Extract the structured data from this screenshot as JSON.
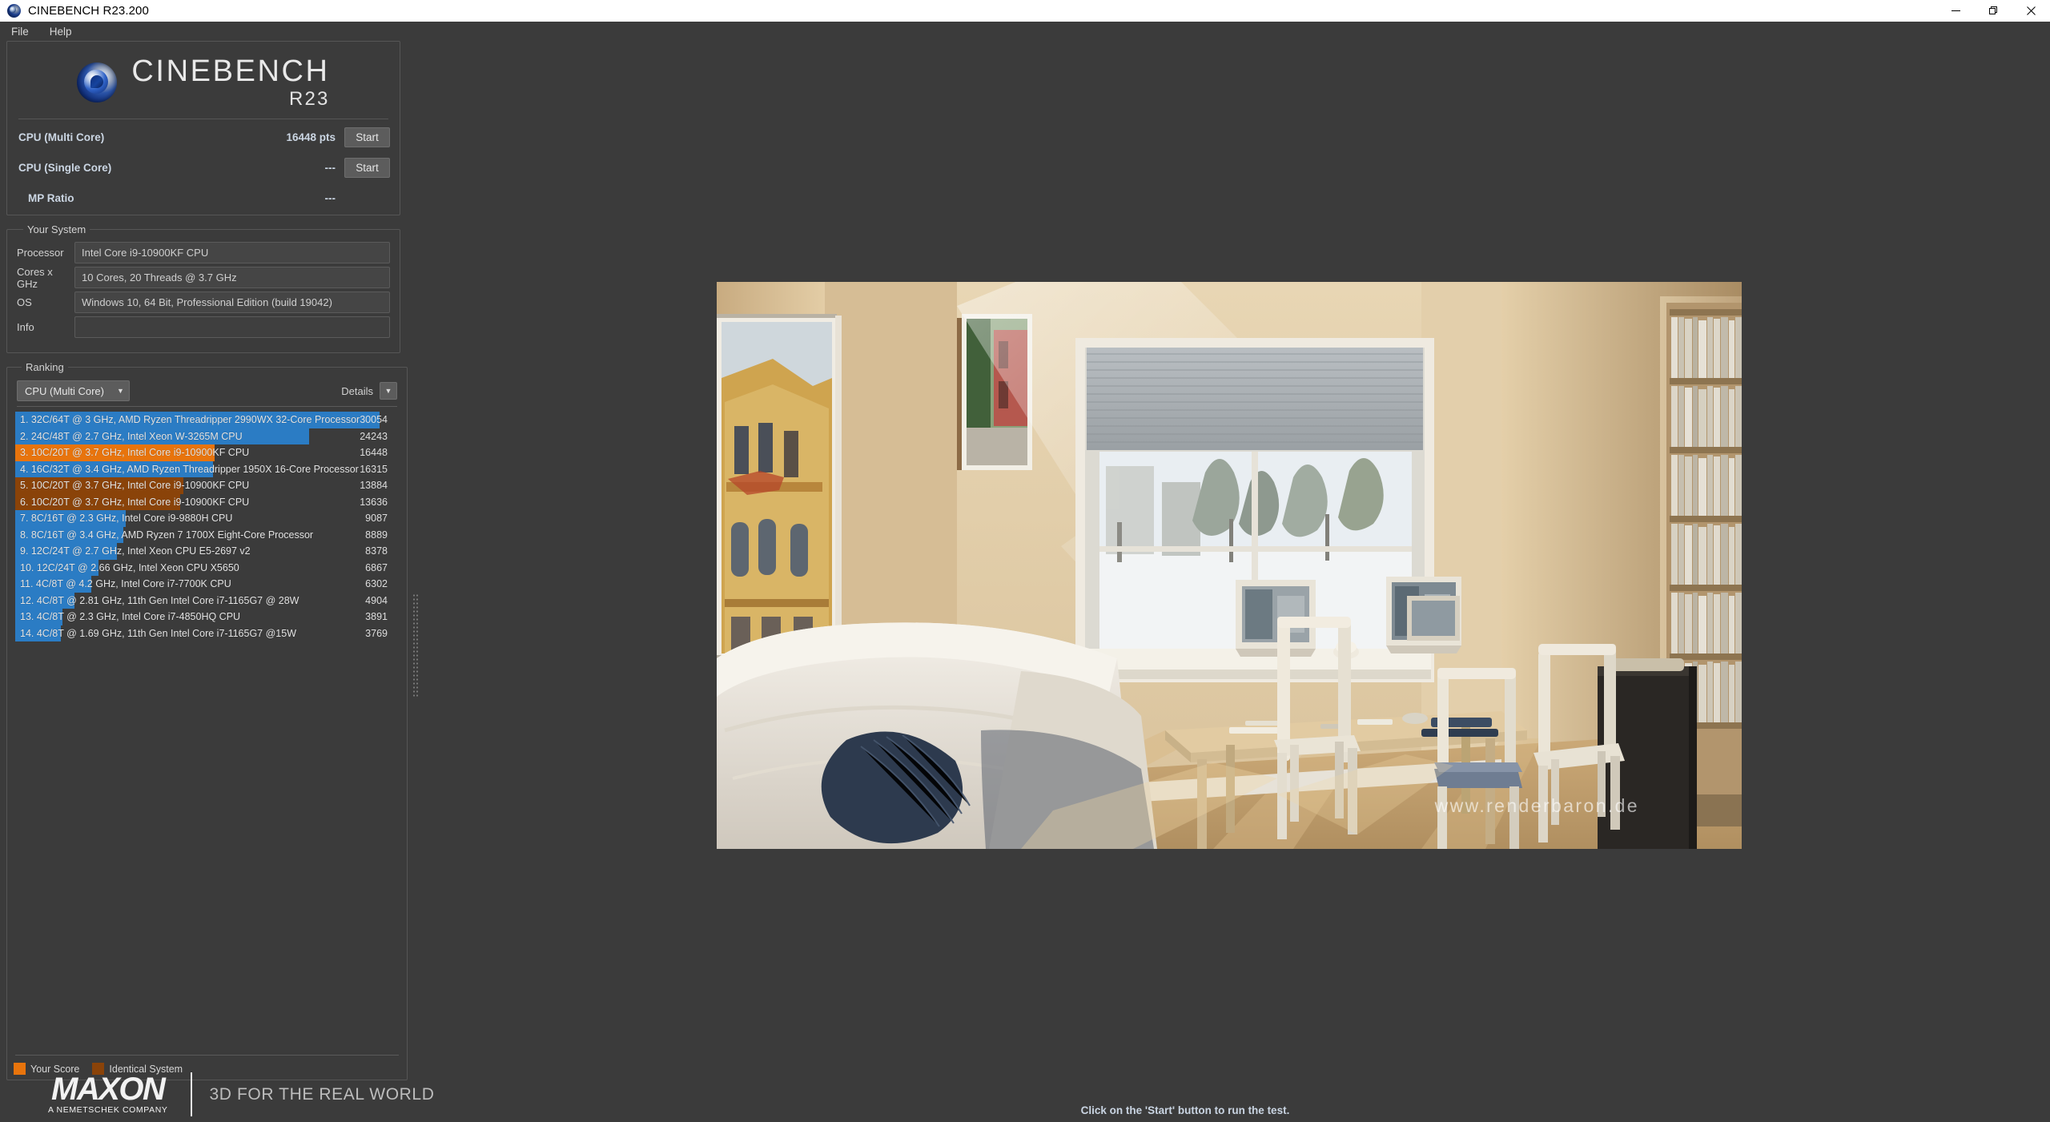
{
  "window": {
    "title": "CINEBENCH R23.200",
    "icon": "cinebench-logo-icon",
    "controls": {
      "minimize": "minimize-icon",
      "maximize": "maximize-icon",
      "close": "close-icon"
    }
  },
  "menu": {
    "items": [
      "File",
      "Help"
    ]
  },
  "branding": {
    "name": "CINEBENCH",
    "version": "R23",
    "footer_logo": "MAXON",
    "footer_sub": "A NEMETSCHEK COMPANY",
    "footer_tagline": "3D FOR THE REAL WORLD"
  },
  "scores": {
    "rows": [
      {
        "label": "CPU (Multi Core)",
        "value": "16448 pts",
        "button": "Start",
        "has_button": true
      },
      {
        "label": "CPU (Single Core)",
        "value": "---",
        "button": "Start",
        "has_button": true
      },
      {
        "label": "MP Ratio",
        "value": "---",
        "button": "",
        "has_button": false
      }
    ]
  },
  "system": {
    "title": "Your System",
    "fields": [
      {
        "label": "Processor",
        "value": "Intel Core i9-10900KF CPU"
      },
      {
        "label": "Cores x GHz",
        "value": "10 Cores, 20 Threads @ 3.7 GHz"
      },
      {
        "label": "OS",
        "value": "Windows 10, 64 Bit, Professional Edition (build 19042)"
      },
      {
        "label": "Info",
        "value": ""
      }
    ]
  },
  "ranking": {
    "title": "Ranking",
    "selected_mode": "CPU (Multi Core)",
    "details_label": "Details",
    "dropdown_icon": "chevron-down-icon",
    "details_icon": "chevron-down-icon",
    "legend": [
      {
        "label": "Your Score",
        "color": "#e8740c"
      },
      {
        "label": "Identical System",
        "color": "#8a4309"
      }
    ],
    "colors": {
      "other": "#2b7cc4",
      "your_score": "#e8740c",
      "identical": "#8a4309"
    },
    "max_score": 30054,
    "rows": [
      {
        "rank": 1,
        "text": "1. 32C/64T @ 3 GHz, AMD Ryzen Threadripper 2990WX 32-Core Processor",
        "score": 30054,
        "type": "other"
      },
      {
        "rank": 2,
        "text": "2. 24C/48T @ 2.7 GHz, Intel Xeon W-3265M CPU",
        "score": 24243,
        "type": "other"
      },
      {
        "rank": 3,
        "text": "3. 10C/20T @ 3.7 GHz, Intel Core i9-10900KF CPU",
        "score": 16448,
        "type": "your_score"
      },
      {
        "rank": 4,
        "text": "4. 16C/32T @ 3.4 GHz, AMD Ryzen Threadripper 1950X 16-Core Processor",
        "score": 16315,
        "type": "other"
      },
      {
        "rank": 5,
        "text": "5. 10C/20T @ 3.7 GHz, Intel Core i9-10900KF CPU",
        "score": 13884,
        "type": "identical"
      },
      {
        "rank": 6,
        "text": "6. 10C/20T @ 3.7 GHz, Intel Core i9-10900KF CPU",
        "score": 13636,
        "type": "identical"
      },
      {
        "rank": 7,
        "text": "7. 8C/16T @ 2.3 GHz, Intel Core i9-9880H CPU",
        "score": 9087,
        "type": "other"
      },
      {
        "rank": 8,
        "text": "8. 8C/16T @ 3.4 GHz, AMD Ryzen 7 1700X Eight-Core Processor",
        "score": 8889,
        "type": "other"
      },
      {
        "rank": 9,
        "text": "9. 12C/24T @ 2.7 GHz, Intel Xeon CPU E5-2697 v2",
        "score": 8378,
        "type": "other"
      },
      {
        "rank": 10,
        "text": "10. 12C/24T @ 2.66 GHz, Intel Xeon CPU X5650",
        "score": 6867,
        "type": "other"
      },
      {
        "rank": 11,
        "text": "11. 4C/8T @ 4.2 GHz, Intel Core i7-7700K CPU",
        "score": 6302,
        "type": "other"
      },
      {
        "rank": 12,
        "text": "12. 4C/8T @ 2.81 GHz, 11th Gen Intel Core i7-1165G7 @ 28W",
        "score": 4904,
        "type": "other"
      },
      {
        "rank": 13,
        "text": "13. 4C/8T @ 2.3 GHz, Intel Core i7-4850HQ CPU",
        "score": 3891,
        "type": "other"
      },
      {
        "rank": 14,
        "text": "14. 4C/8T @ 1.69 GHz, 11th Gen Intel Core i7-1165G7 @15W",
        "score": 3769,
        "type": "other"
      }
    ]
  },
  "status": {
    "text": "Click on the 'Start' button to run the test."
  },
  "render_preview": {
    "watermark": "www.renderbaron.de",
    "description": "3D rendered living room scene with window, dining table, chairs, sofa and bookshelf"
  }
}
